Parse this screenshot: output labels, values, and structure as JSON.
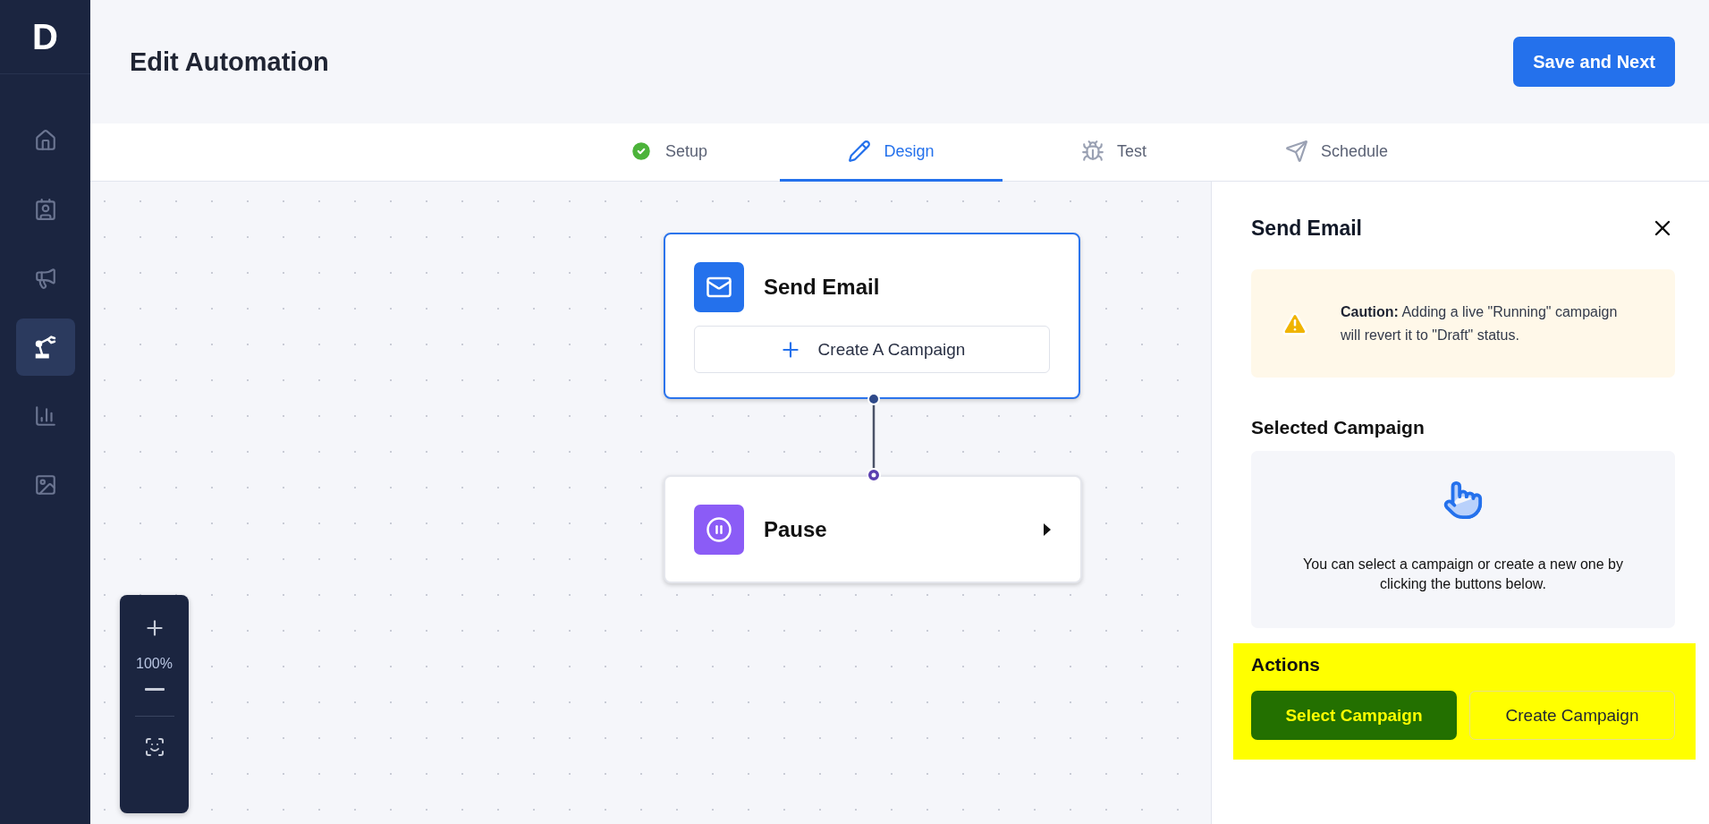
{
  "logo": "D",
  "sidebar": {
    "items": [
      {
        "selected": false
      },
      {
        "selected": false
      },
      {
        "selected": false
      },
      {
        "selected": true
      },
      {
        "selected": false
      },
      {
        "selected": false
      }
    ]
  },
  "header": {
    "title": "Edit Automation",
    "primary_button": "Save and Next"
  },
  "tabs": [
    {
      "label": "Setup",
      "selected": false,
      "completed": true
    },
    {
      "label": "Design",
      "selected": true,
      "completed": false
    },
    {
      "label": "Test",
      "selected": false,
      "completed": false
    },
    {
      "label": "Schedule",
      "selected": false,
      "completed": false
    }
  ],
  "canvas": {
    "nodes": [
      {
        "kind": "send_email",
        "title": "Send Email",
        "selected": true,
        "action": "Create A Campaign"
      },
      {
        "kind": "pause",
        "title": "Pause",
        "selected": false
      }
    ],
    "zoom": "100%"
  },
  "panel": {
    "title": "Send Email",
    "caution": "**Caution:** Adding a live \"Running\" campaign will revert it to \"Draft\" status.",
    "selected_campaign": {
      "heading": "Selected Campaign",
      "hint": "You can select a campaign or create a new one by clicking the buttons below."
    },
    "actions": {
      "heading": "Actions",
      "highlighted": true,
      "buttons": [
        {
          "label": "Select Campaign",
          "kind": "primary"
        },
        {
          "label": "Create Campaign",
          "kind": "secondary"
        }
      ]
    }
  }
}
